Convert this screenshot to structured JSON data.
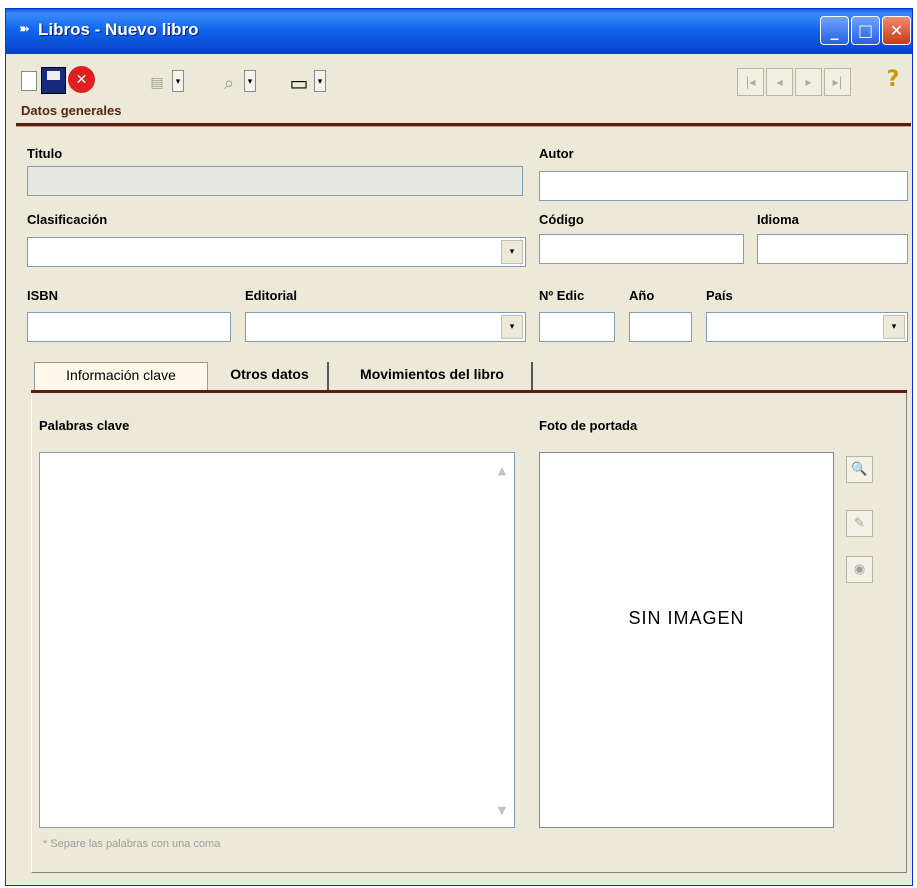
{
  "window": {
    "title": "Libros - Nuevo libro",
    "controls": {
      "minimize": "_",
      "maximize": "□",
      "close": "✕"
    }
  },
  "toolbar": {
    "icons": [
      "new-document-icon",
      "save-icon",
      "cancel-icon",
      "print-icon",
      "find-icon",
      "view-icon",
      "first-record-icon",
      "prev-record-icon",
      "next-record-icon",
      "last-record-icon",
      "help-icon"
    ],
    "glyphs": {
      "cancel": "✕",
      "print": "▤",
      "find": "⌕",
      "view": "▭",
      "dropdown": "▾",
      "first": "|◂",
      "prev": "◂",
      "next": "▸",
      "last": "▸|",
      "help": "?"
    }
  },
  "section": {
    "title": "Datos generales"
  },
  "fields": {
    "titulo": {
      "label": "Titulo",
      "value": ""
    },
    "autor": {
      "label": "Autor",
      "value": ""
    },
    "clasificacion": {
      "label": "Clasificación",
      "value": ""
    },
    "codigo": {
      "label": "Código",
      "value": ""
    },
    "idioma": {
      "label": "Idioma",
      "value": ""
    },
    "isbn": {
      "label": "ISBN",
      "value": ""
    },
    "editorial": {
      "label": "Editorial",
      "value": ""
    },
    "num_edic": {
      "label": "Nº Edic",
      "value": ""
    },
    "anio": {
      "label": "Año",
      "value": ""
    },
    "pais": {
      "label": "País",
      "value": ""
    }
  },
  "tabs": [
    {
      "label": "Información clave",
      "active": true
    },
    {
      "label": "Otros datos",
      "active": false
    },
    {
      "label": "Movimientos del libro",
      "active": false
    }
  ],
  "info_tab": {
    "keywords_label": "Palabras clave",
    "keywords_value": "",
    "cover_label": "Foto de portada",
    "no_image": "SIN IMAGEN",
    "hint": "* Separe las palabras con una coma",
    "scroll_up": "▲",
    "scroll_down": "▼",
    "image_buttons": [
      "load-image-icon",
      "edit-image-icon",
      "view-image-icon"
    ],
    "image_glyphs": {
      "load": "🔍",
      "edit": "✎",
      "view": "◉"
    }
  },
  "colors": {
    "accent": "#5a1c0c",
    "title_bar": "#0a4fd6",
    "background": "#ece9d8"
  }
}
